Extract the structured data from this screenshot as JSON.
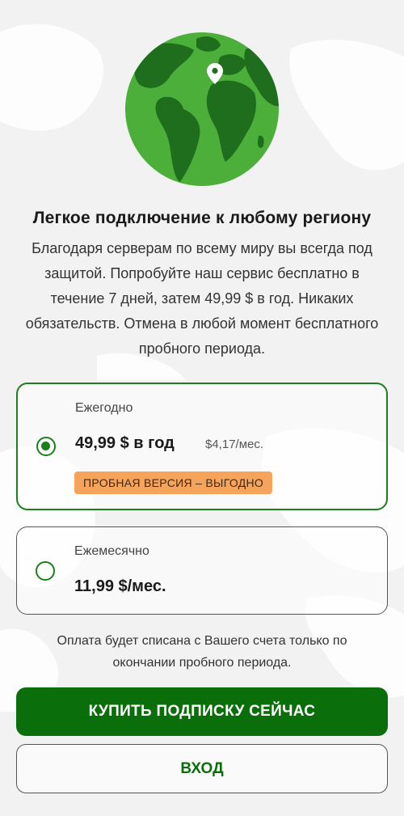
{
  "colors": {
    "accent": "#0a6e0a",
    "selected_border": "#1b7f1b",
    "badge_bg": "#f6a35b",
    "globe_ocean": "#4caf3a",
    "globe_land": "#1e6e1e",
    "background": "#f2f2f2"
  },
  "hero": {
    "icon": "globe-icon",
    "pin_icon": "location-pin-icon"
  },
  "headline": "Легкое подключение к любому региону",
  "description": "Благодаря серверам по всему миру вы всегда под защитой. Попробуйте наш сервис бесплатно в течение 7 дней, затем 49,99 $ в год. Никаких обязательств. Отмена в любой момент бесплатного пробного периода.",
  "plans": {
    "yearly": {
      "label": "Ежегодно",
      "price": "49,99 $ в год",
      "per_month": "$4,17/мес.",
      "badge": "ПРОБНАЯ ВЕРСИЯ – ВЫГОДНО",
      "selected": true
    },
    "monthly": {
      "label": "Ежемесячно",
      "price": "11,99 $/мес.",
      "selected": false
    }
  },
  "note": "Оплата будет списана с Вашего счета только по окончании пробного периода.",
  "buttons": {
    "buy": "КУПИТЬ ПОДПИСКУ СЕЙЧАС",
    "login": "ВХОД"
  }
}
